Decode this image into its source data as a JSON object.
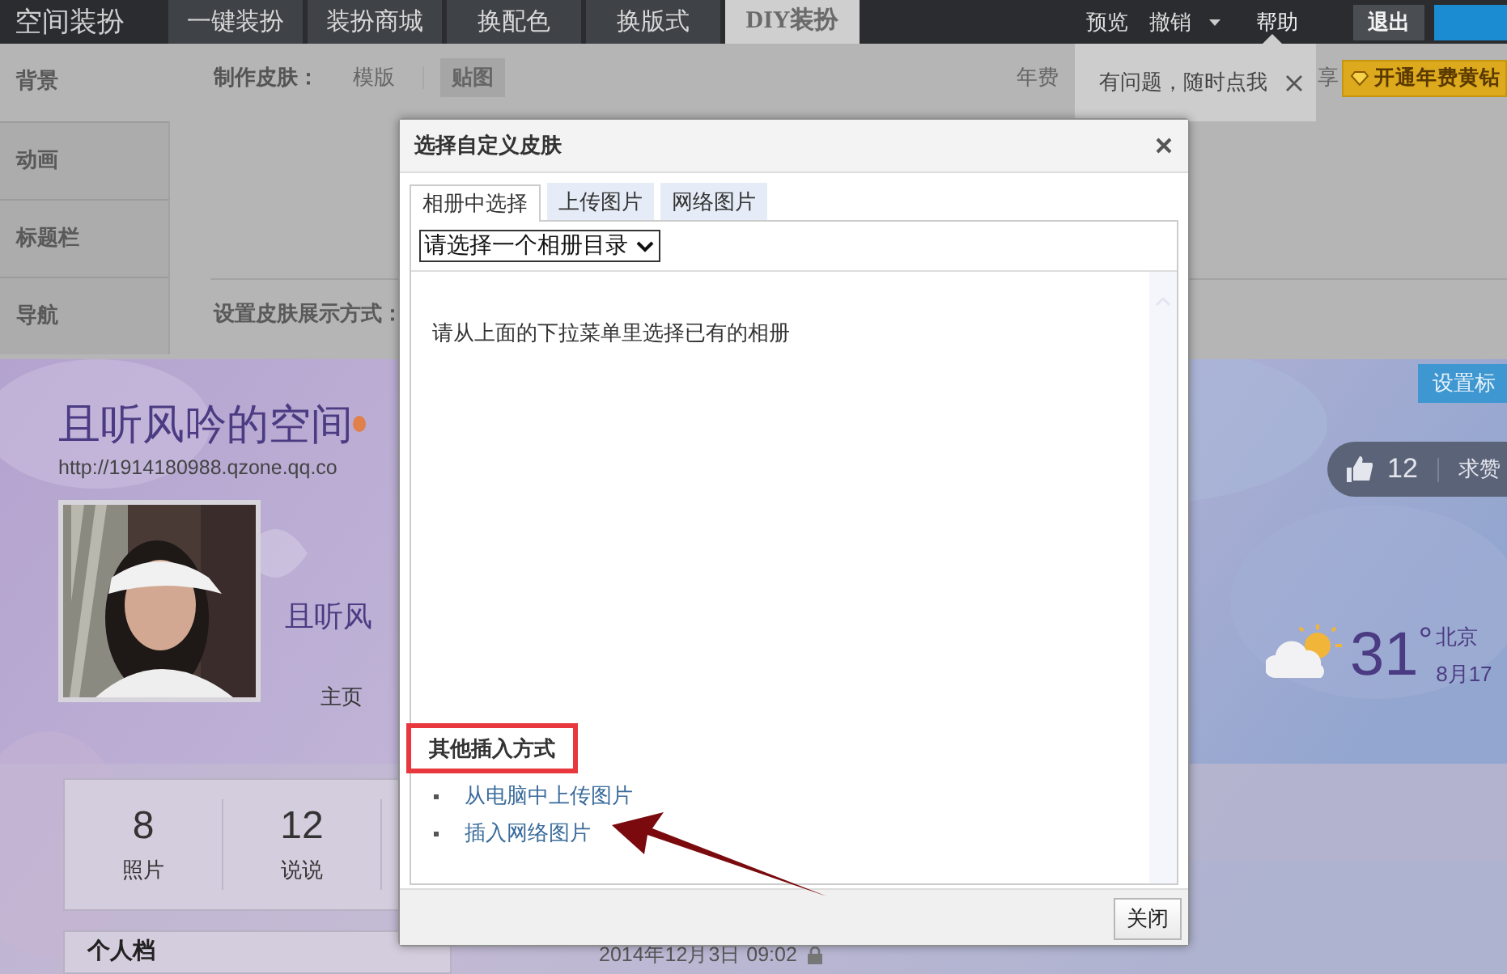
{
  "top_bar": {
    "logo": "空间装扮",
    "tabs": [
      {
        "label": "一键装扮",
        "selected": false
      },
      {
        "label": "装扮商城",
        "selected": false
      },
      {
        "label": "换配色",
        "selected": false
      },
      {
        "label": "换版式",
        "selected": false
      },
      {
        "label": "DIY装扮",
        "selected": true
      }
    ],
    "links": [
      "预览",
      "撤销"
    ],
    "help": "帮助",
    "logout": "退出"
  },
  "help_tip": {
    "text": "有问题，随时点我"
  },
  "sidebar": {
    "items": [
      {
        "label": "背景",
        "selected": true
      },
      {
        "label": "动画",
        "selected": false
      },
      {
        "label": "标题栏",
        "selected": false
      },
      {
        "label": "导航",
        "selected": false
      }
    ]
  },
  "editor": {
    "skin_label": "制作皮肤：",
    "modes": [
      {
        "label": "模版",
        "selected": false
      },
      {
        "label": "贴图",
        "selected": true
      }
    ],
    "fee_text": "年费",
    "privilege": "享",
    "vip_button": "开通年费黄钻",
    "display_label": "设置皮肤展示方式："
  },
  "profile": {
    "title": "且听风吟的空间",
    "url": "http://1914180988.qzone.qq.co",
    "name": "且听风",
    "home_link": "主页",
    "stats": [
      {
        "value": "8",
        "label": "照片"
      },
      {
        "value": "12",
        "label": "说说"
      }
    ],
    "section_title": "个人档",
    "post_date": "2014年12月3日 09:02",
    "title_button": "设置标",
    "likes": "12",
    "like_request": "求赞",
    "weather": {
      "temperature": "31",
      "unit": "°",
      "city": "北京",
      "date": "8月17"
    }
  },
  "dialog": {
    "title": "选择自定义皮肤",
    "tabs": [
      {
        "label": "相册中选择",
        "selected": true
      },
      {
        "label": "上传图片",
        "selected": false
      },
      {
        "label": "网络图片",
        "selected": false
      }
    ],
    "album_select": "请选择一个相册目录",
    "message": "请从上面的下拉菜单里选择已有的相册",
    "other_methods": {
      "heading": "其他插入方式",
      "highlighted": true,
      "links": [
        "从电脑中上传图片",
        "插入网络图片"
      ]
    },
    "close_button": "关闭"
  },
  "annotations": [
    {
      "kind": "arrow"
    }
  ]
}
